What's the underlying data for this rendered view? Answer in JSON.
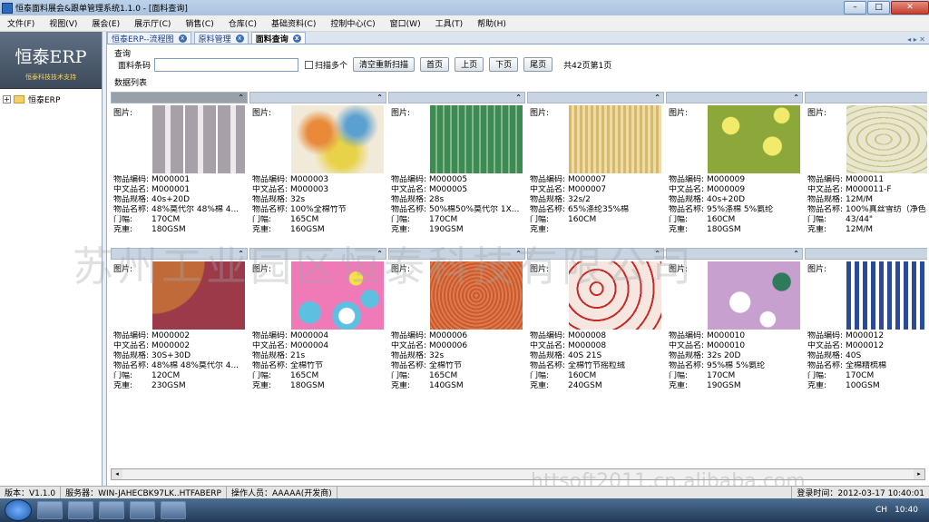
{
  "window": {
    "title": "恒泰面料展会&跟单管理系统1.1.0 - [面料查询]",
    "min": "–",
    "max": "□",
    "close": "✕"
  },
  "menu": [
    "文件(F)",
    "视图(V)",
    "展会(E)",
    "展示厅(C)",
    "销售(C)",
    "仓库(C)",
    "基础资料(C)",
    "控制中心(C)",
    "窗口(W)",
    "工具(T)",
    "帮助(H)"
  ],
  "sidebar": {
    "logo_title": "恒泰ERP",
    "logo_sub": "恒泰科技技术支持",
    "tree_root": "恒泰ERP",
    "tree_expander": "+"
  },
  "tabs": [
    {
      "label": "恒泰ERP--流程图"
    },
    {
      "label": "原料管理"
    },
    {
      "label": "面料查询"
    }
  ],
  "tab_nav": "◂ ▸ ✕",
  "query": {
    "section_label": "查询",
    "barcode_label": "面料条码",
    "barcode_value": "",
    "scan_multi": "扫描多个",
    "clear_btn": "清空重新扫描",
    "first": "首页",
    "prev": "上页",
    "next": "下页",
    "last": "尾页",
    "page_info": "共42页第1页"
  },
  "list_label": "数据列表",
  "field_labels": {
    "image": "图片:",
    "code": "物品编码:",
    "cn_name": "中文品名:",
    "spec": "物品规格:",
    "name": "物品名称:",
    "width": "门幅:",
    "weight": "克重:"
  },
  "collapse_icon": "chevron-up-icon",
  "collapse_glyph": "⌃",
  "items": [
    {
      "code": "M000001",
      "cn_name": "M000001",
      "spec": "40s+20D",
      "name": "48%莫代尔 48%棉 4...",
      "width": "170CM",
      "weight": "180GSM",
      "pattern": "plaid",
      "c1": "#a8a0a8",
      "c2": "#ece8ec"
    },
    {
      "code": "M000003",
      "cn_name": "M000003",
      "spec": "32s",
      "name": "100%全棉竹节",
      "width": "165CM",
      "weight": "160GSM",
      "pattern": "watercolor",
      "c1": "#e8d24a",
      "c2": "#f2ead8"
    },
    {
      "code": "M000005",
      "cn_name": "M000005",
      "spec": "28s",
      "name": "50%棉50%莫代尔 1X...",
      "width": "170CM",
      "weight": "190GSM",
      "pattern": "check",
      "c1": "#3f8a52",
      "c2": "#7fb88a"
    },
    {
      "code": "M000007",
      "cn_name": "M000007",
      "spec": "32s/2",
      "name": "65%涤纶35%棉",
      "width": "160CM",
      "weight": "",
      "pattern": "stripe",
      "c1": "#d8b86a",
      "c2": "#f0dca0"
    },
    {
      "code": "M000009",
      "cn_name": "M000009",
      "spec": "40s+20D",
      "name": "95%涤棉 5%氨纶",
      "width": "160CM",
      "weight": "180GSM",
      "pattern": "floral",
      "c1": "#8ca83a",
      "c2": "#f2ea6a"
    },
    {
      "code": "M000011",
      "cn_name": "M000011-F",
      "spec": "12M/M",
      "name": "100%真丝雪纺（净色",
      "width": "43/44\"",
      "weight": "12M/M",
      "pattern": "leaf",
      "c1": "#e8e6cc",
      "c2": "#c8c28a"
    },
    {
      "code": "M000002",
      "cn_name": "M000002",
      "spec": "30S+30D",
      "name": "48%棉 48%莫代尔 4...",
      "width": "120CM",
      "weight": "230GSM",
      "pattern": "solid",
      "c1": "#9c3a4a",
      "c2": "#c06a3a"
    },
    {
      "code": "M000004",
      "cn_name": "M000004",
      "spec": "21s",
      "name": "全棉竹节",
      "width": "165CM",
      "weight": "180GSM",
      "pattern": "dots",
      "c1": "#f07ab8",
      "c2": "#5ec0e0"
    },
    {
      "code": "M000006",
      "cn_name": "M000006",
      "spec": "32s",
      "name": "全棉竹节",
      "width": "165CM",
      "weight": "140GSM",
      "pattern": "texture",
      "c1": "#e07a4a",
      "c2": "#c85a30"
    },
    {
      "code": "M000008",
      "cn_name": "M000008",
      "spec": "40S 21S",
      "name": "全棉竹节摇粒绒",
      "width": "160CM",
      "weight": "240GSM",
      "pattern": "lace",
      "c1": "#c82a2a",
      "c2": "#f6e6e0"
    },
    {
      "code": "M000010",
      "cn_name": "M000010",
      "spec": "32s 20D",
      "name": "95%棉 5%氨纶",
      "width": "170CM",
      "weight": "190GSM",
      "pattern": "flower",
      "c1": "#c8a0d0",
      "c2": "#2e7a5a"
    },
    {
      "code": "M000012",
      "cn_name": "M000012",
      "spec": "40S",
      "name": "全棉精梳棉",
      "width": "170CM",
      "weight": "100GSM",
      "pattern": "gingham",
      "c1": "#2a4a9a",
      "c2": "#ffffff"
    }
  ],
  "scroll": {
    "left": "◂",
    "right": "▸"
  },
  "status": {
    "version": "版本：V1.1.0",
    "server": "服务器：WIN-JAHECBK97LK..HTFABERP",
    "operator": "操作人员：AAAAA(开发商)",
    "login": "登录时间：2012-03-17 10:40:01"
  },
  "taskbar": {
    "lang": "CH",
    "clock": "10:40"
  },
  "watermark": "苏州工业园区恒泰科技有限公司",
  "watermark2": "httsoft2011.cn.alibaba.com"
}
